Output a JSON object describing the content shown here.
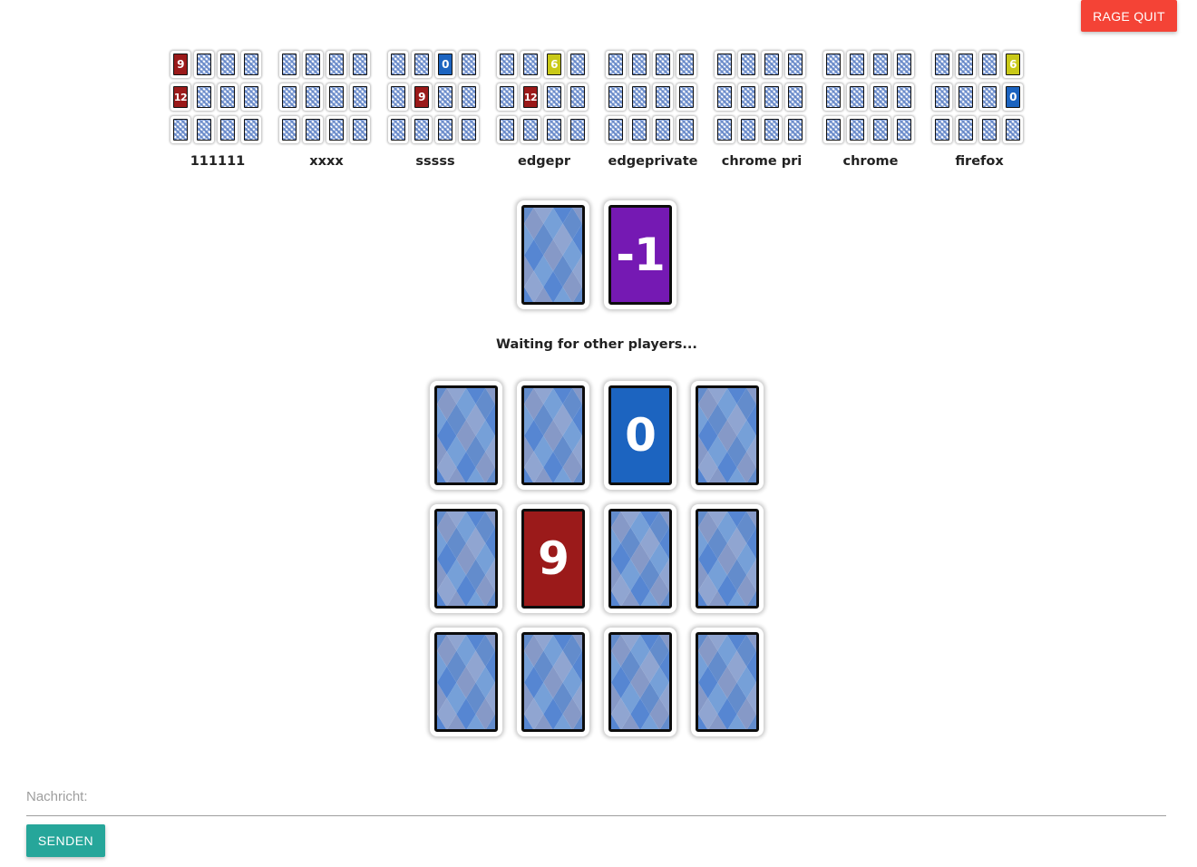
{
  "header": {
    "rage_quit_label": "RAGE QUIT"
  },
  "colors": {
    "purple": "#7519b3",
    "blue": "#1c64c0",
    "red": "#9b1a1a",
    "yellow": "#c9c918",
    "rage_quit": "#f44336",
    "send": "#26a69a"
  },
  "players": [
    {
      "name": "111111",
      "cards": [
        [
          {
            "value": "9",
            "color": "red"
          },
          null,
          null,
          null
        ],
        [
          {
            "value": "12",
            "color": "red"
          },
          null,
          null,
          null
        ],
        [
          null,
          null,
          null,
          null
        ]
      ]
    },
    {
      "name": "xxxx",
      "cards": [
        [
          null,
          null,
          null,
          null
        ],
        [
          null,
          null,
          null,
          null
        ],
        [
          null,
          null,
          null,
          null
        ]
      ]
    },
    {
      "name": "sssss",
      "cards": [
        [
          null,
          null,
          {
            "value": "0",
            "color": "blue"
          },
          null
        ],
        [
          null,
          {
            "value": "9",
            "color": "red"
          },
          null,
          null
        ],
        [
          null,
          null,
          null,
          null
        ]
      ]
    },
    {
      "name": "edgepr",
      "cards": [
        [
          null,
          null,
          {
            "value": "6",
            "color": "yellow"
          },
          null
        ],
        [
          null,
          {
            "value": "12",
            "color": "red"
          },
          null,
          null
        ],
        [
          null,
          null,
          null,
          null
        ]
      ]
    },
    {
      "name": "edgeprivate",
      "cards": [
        [
          null,
          null,
          null,
          null
        ],
        [
          null,
          null,
          null,
          null
        ],
        [
          null,
          null,
          null,
          null
        ]
      ]
    },
    {
      "name": "chrome pri",
      "cards": [
        [
          null,
          null,
          null,
          null
        ],
        [
          null,
          null,
          null,
          null
        ],
        [
          null,
          null,
          null,
          null
        ]
      ]
    },
    {
      "name": "chrome",
      "cards": [
        [
          null,
          null,
          null,
          null
        ],
        [
          null,
          null,
          null,
          null
        ],
        [
          null,
          null,
          null,
          null
        ]
      ]
    },
    {
      "name": "firefox",
      "cards": [
        [
          null,
          null,
          null,
          {
            "value": "6",
            "color": "yellow"
          }
        ],
        [
          null,
          null,
          null,
          {
            "value": "0",
            "color": "blue"
          }
        ],
        [
          null,
          null,
          null,
          null
        ]
      ]
    }
  ],
  "piles": {
    "draw_pile": {
      "face": "back"
    },
    "discard_pile": {
      "value": "-1",
      "color": "purple"
    }
  },
  "status": "Waiting for other players...",
  "my_cards": [
    [
      null,
      null,
      {
        "value": "0",
        "color": "blue"
      },
      null
    ],
    [
      null,
      {
        "value": "9",
        "color": "red"
      },
      null,
      null
    ],
    [
      null,
      null,
      null,
      null
    ]
  ],
  "chat": {
    "label": "Nachricht:",
    "value": "",
    "send_label": "SENDEN"
  }
}
